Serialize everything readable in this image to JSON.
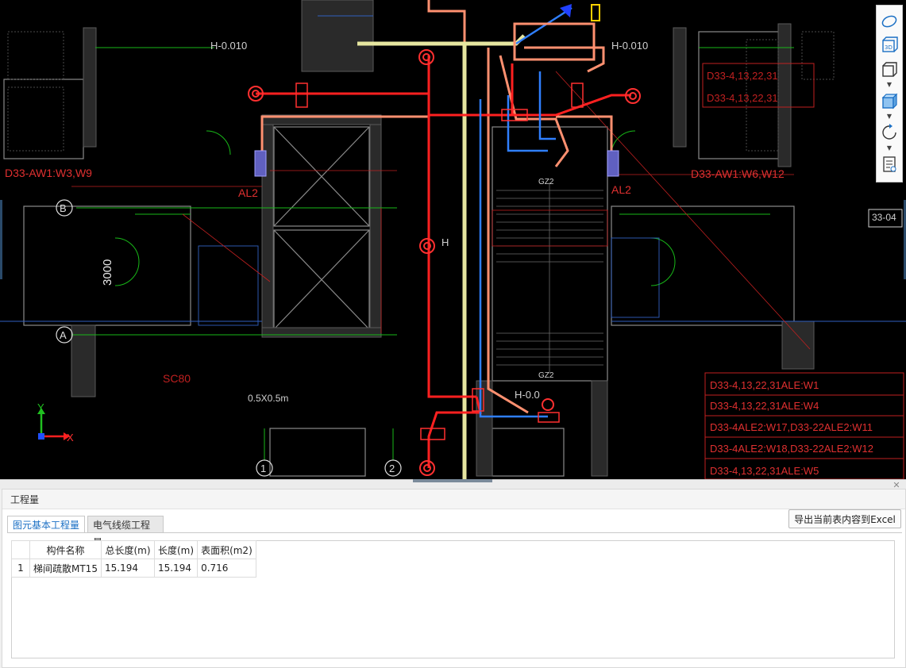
{
  "cad": {
    "dimension_label": "3000",
    "axis_labels": {
      "B": "B",
      "A": "A",
      "one": "1",
      "two": "2"
    },
    "elevation_left": "H-0.010",
    "elevation_right": "H-0.010",
    "elevation_bottom": "H-0.0",
    "al2_left": "AL2",
    "al2_right": "AL2",
    "circuit_left": "D33-AW1:W3,W9",
    "circuit_right": "D33-AW1:W6,W12",
    "circuit_top_right_1": "D33-4,13,22,31",
    "circuit_top_right_2": "D33-4,13,22,31",
    "sc80_label": "SC80",
    "shaft_size": "0.5X0.5m",
    "gz2_top": "GZ2",
    "gz2_bottom": "GZ2",
    "pipe_h": "H",
    "room_tag": "33-04",
    "right_legend": [
      "D33-4,13,22,31ALE:W1",
      "D33-4,13,22,31ALE:W4",
      "D33-4ALE2:W17,D33-22ALE2:W11",
      "D33-4ALE2:W18,D33-22ALE2:W12",
      "D33-4,13,22,31ALE:W5"
    ],
    "axis_x": "X",
    "axis_y": "Y"
  },
  "toolbar": {
    "icons": [
      "orbit-icon",
      "3d-view-icon",
      "cube-icon",
      "cube-shaded-icon",
      "rotate-icon",
      "properties-icon"
    ]
  },
  "panel": {
    "title": "工程量",
    "tabs": [
      "图元基本工程量",
      "电气线缆工程量"
    ],
    "active_tab": 0,
    "export_button": "导出当前表内容到Excel",
    "table": {
      "headers": [
        "",
        "构件名称",
        "总长度(m)",
        "长度(m)",
        "表面积(m2)"
      ],
      "rows": [
        [
          "1",
          "梯间疏散MT15",
          "15.194",
          "15.194",
          "0.716"
        ]
      ]
    }
  },
  "colors": {
    "background": "#000000",
    "wall": "#8a8a8a",
    "red_pipe": "#ff2020",
    "salmon_pipe": "#ff9070",
    "blue_pipe": "#2f7fff",
    "yellow_pipe": "#e6e6a0",
    "green_line": "#18b818",
    "tab_active": "#1a6fc4"
  }
}
